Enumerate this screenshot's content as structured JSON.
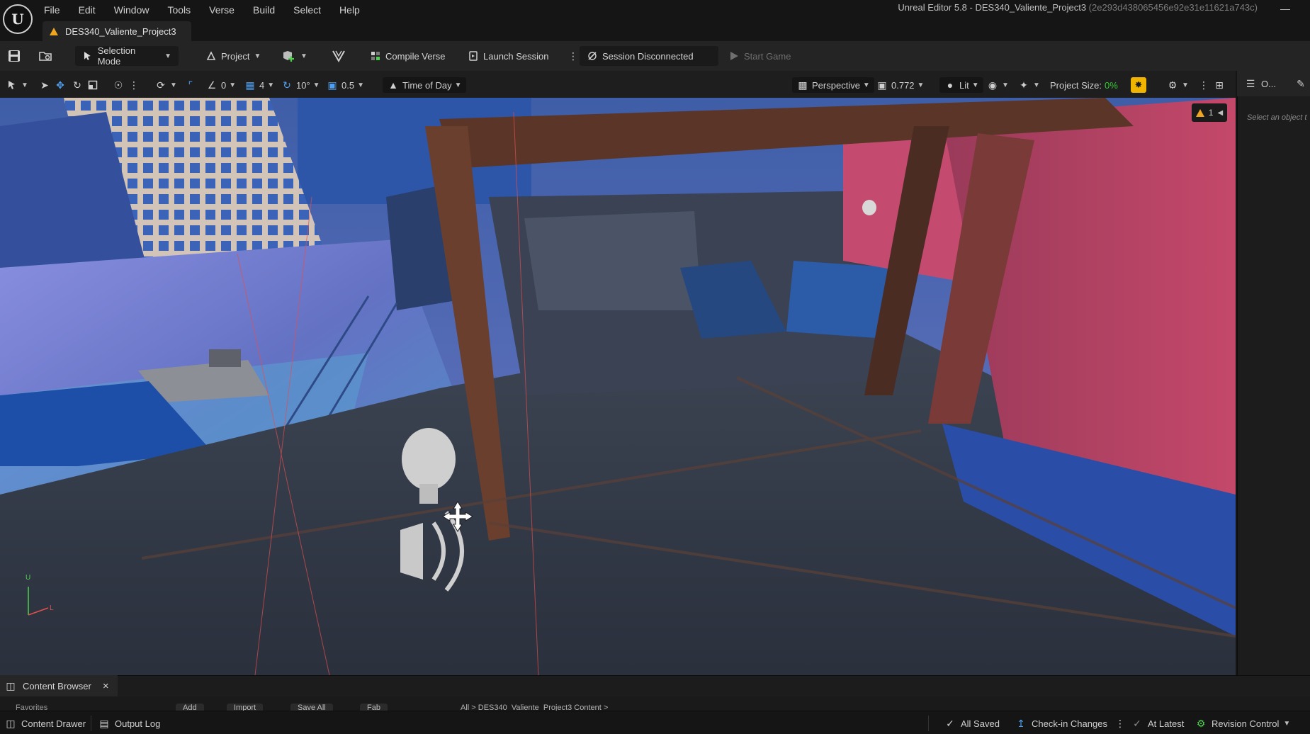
{
  "app": {
    "logo_text": "U",
    "menu": [
      "File",
      "Edit",
      "Window",
      "Tools",
      "Verse",
      "Build",
      "Select",
      "Help"
    ],
    "window_title": "Unreal Editor 5.8 - DES340_Valiente_Project3",
    "window_hash": "(2e293d438065456e92e31e11621a743c)",
    "min_glyph": "—"
  },
  "tab": {
    "label": "DES340_Valiente_Project3"
  },
  "toolbar": {
    "selection_mode": "Selection Mode",
    "project": "Project",
    "compile_verse": "Compile Verse",
    "launch_session": "Launch Session",
    "session_status": "Session Disconnected",
    "start_game": "Start Game"
  },
  "viewport_toolbar": {
    "rotate_snap_value": "0",
    "grid_snap_value": "4",
    "angle_snap_value": "10°",
    "scale_snap_value": "0.5",
    "time_of_day": "Time of Day",
    "perspective": "Perspective",
    "fov_value": "0.772",
    "view_mode": "Lit",
    "project_size_label": "Project Size:",
    "project_size_value": "0%"
  },
  "viewport": {
    "warning_count": "1",
    "axis_u": "U",
    "axis_l": "L"
  },
  "details_panel": {
    "title": "O...",
    "hint": "Select an object t"
  },
  "content_browser": {
    "tab_label": "Content Browser",
    "close_glyph": "×",
    "peek_add": "Add",
    "peek_import": "Import",
    "peek_saveall": "Save All",
    "peek_fab": "Fab",
    "peek_path": "All  >  DES340_Valiente_Project3 Content  >",
    "peek_favorites": "Favorites"
  },
  "status_bar": {
    "content_drawer": "Content Drawer",
    "output_log": "Output Log",
    "all_saved": "All Saved",
    "check_in": "Check-in Changes",
    "at_latest": "At Latest",
    "revision_control": "Revision Control"
  },
  "colors": {
    "accent_yellow": "#f0b400",
    "project_size_green": "#32c832",
    "warning_orange": "#f0a520",
    "transform_blue": "#4f9ff0"
  }
}
